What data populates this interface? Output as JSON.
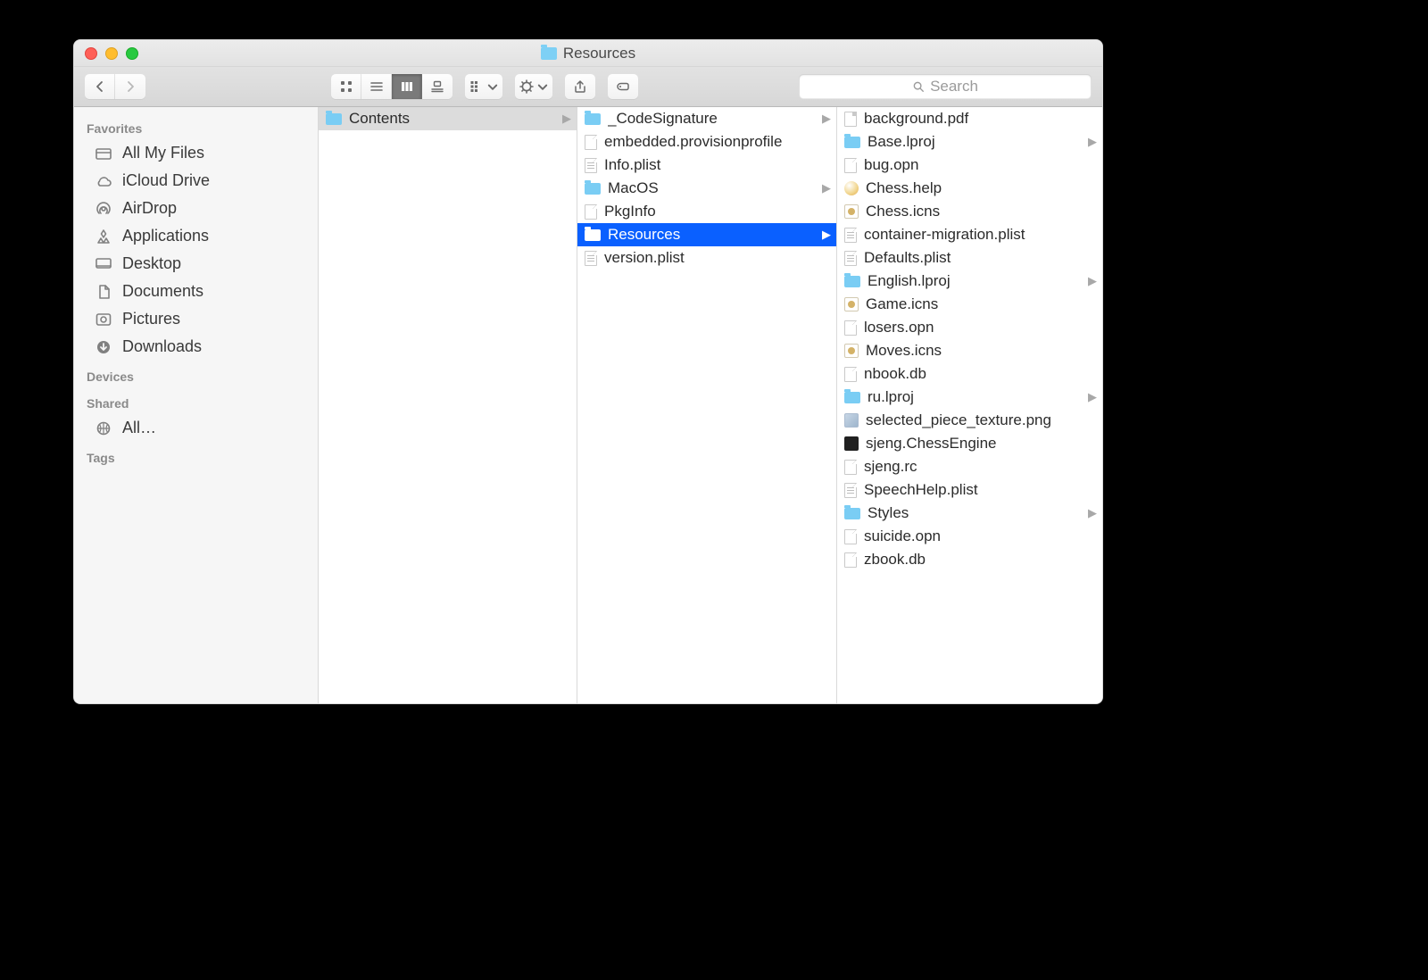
{
  "window": {
    "title": "Resources"
  },
  "toolbar": {
    "search_placeholder": "Search"
  },
  "sidebar": {
    "sections": [
      {
        "header": "Favorites",
        "items": [
          {
            "icon": "all-files",
            "label": "All My Files"
          },
          {
            "icon": "icloud",
            "label": "iCloud Drive"
          },
          {
            "icon": "airdrop",
            "label": "AirDrop"
          },
          {
            "icon": "apps",
            "label": "Applications"
          },
          {
            "icon": "desktop",
            "label": "Desktop"
          },
          {
            "icon": "documents",
            "label": "Documents"
          },
          {
            "icon": "pictures",
            "label": "Pictures"
          },
          {
            "icon": "downloads",
            "label": "Downloads"
          }
        ]
      },
      {
        "header": "Devices",
        "items": []
      },
      {
        "header": "Shared",
        "items": [
          {
            "icon": "network",
            "label": "All…"
          }
        ]
      },
      {
        "header": "Tags",
        "items": []
      }
    ]
  },
  "columns": [
    {
      "items": [
        {
          "name": "Contents",
          "type": "folder",
          "is_folder": true,
          "selected": "grey"
        }
      ]
    },
    {
      "items": [
        {
          "name": "_CodeSignature",
          "type": "folder",
          "is_folder": true
        },
        {
          "name": "embedded.provisionprofile",
          "type": "doc"
        },
        {
          "name": "Info.plist",
          "type": "plist"
        },
        {
          "name": "MacOS",
          "type": "folder",
          "is_folder": true
        },
        {
          "name": "PkgInfo",
          "type": "doc"
        },
        {
          "name": "Resources",
          "type": "folder",
          "is_folder": true,
          "selected": "blue"
        },
        {
          "name": "version.plist",
          "type": "plist"
        }
      ]
    },
    {
      "items": [
        {
          "name": "background.pdf",
          "type": "pdf"
        },
        {
          "name": "Base.lproj",
          "type": "folder",
          "is_folder": true
        },
        {
          "name": "bug.opn",
          "type": "doc"
        },
        {
          "name": "Chess.help",
          "type": "help"
        },
        {
          "name": "Chess.icns",
          "type": "icns"
        },
        {
          "name": "container-migration.plist",
          "type": "plist"
        },
        {
          "name": "Defaults.plist",
          "type": "plist"
        },
        {
          "name": "English.lproj",
          "type": "folder",
          "is_folder": true
        },
        {
          "name": "Game.icns",
          "type": "icns"
        },
        {
          "name": "losers.opn",
          "type": "doc"
        },
        {
          "name": "Moves.icns",
          "type": "icns"
        },
        {
          "name": "nbook.db",
          "type": "doc"
        },
        {
          "name": "ru.lproj",
          "type": "folder",
          "is_folder": true
        },
        {
          "name": "selected_piece_texture.png",
          "type": "png"
        },
        {
          "name": "sjeng.ChessEngine",
          "type": "exec"
        },
        {
          "name": "sjeng.rc",
          "type": "doc"
        },
        {
          "name": "SpeechHelp.plist",
          "type": "plist"
        },
        {
          "name": "Styles",
          "type": "folder",
          "is_folder": true
        },
        {
          "name": "suicide.opn",
          "type": "doc"
        },
        {
          "name": "zbook.db",
          "type": "doc"
        }
      ]
    }
  ]
}
